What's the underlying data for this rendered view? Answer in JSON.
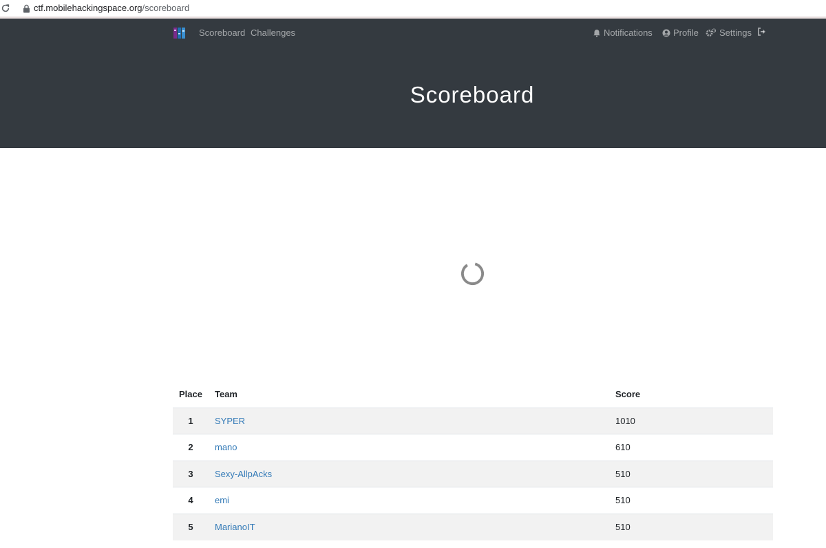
{
  "browser": {
    "url_host": "ctf.mobilehackingspace.org",
    "url_path": "/scoreboard"
  },
  "navbar": {
    "links_left": [
      "Scoreboard",
      "Challenges"
    ],
    "notifications": "Notifications",
    "profile": "Profile",
    "settings": "Settings"
  },
  "hero": {
    "title": "Scoreboard"
  },
  "table": {
    "headers": {
      "place": "Place",
      "team": "Team",
      "score": "Score"
    },
    "rows": [
      {
        "place": "1",
        "team": "SYPER",
        "score": "1010"
      },
      {
        "place": "2",
        "team": "mano",
        "score": "610"
      },
      {
        "place": "3",
        "team": "Sexy-AllpAcks",
        "score": "510"
      },
      {
        "place": "4",
        "team": "emi",
        "score": "510"
      },
      {
        "place": "5",
        "team": "MarianoIT",
        "score": "510"
      }
    ]
  },
  "colors": {
    "navbar_bg": "#343a40",
    "link": "#337ab7",
    "stripe": "#f2f2f2"
  }
}
